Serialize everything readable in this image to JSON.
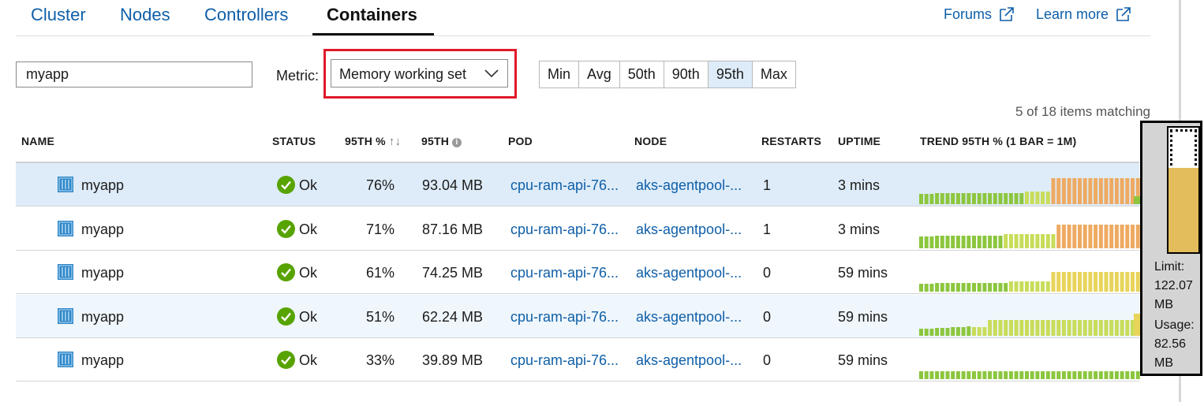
{
  "tabs": [
    {
      "label": "Cluster"
    },
    {
      "label": "Nodes"
    },
    {
      "label": "Controllers"
    },
    {
      "label": "Containers"
    }
  ],
  "links": {
    "forums": "Forums",
    "learn_more": "Learn more"
  },
  "filter": {
    "search_value": "myapp",
    "metric_label": "Metric:",
    "metric_value": "Memory working set"
  },
  "percentiles": [
    "Min",
    "Avg",
    "50th",
    "90th",
    "95th",
    "Max"
  ],
  "active_percentile": "95th",
  "matching": "5 of 18 items matching",
  "columns": {
    "name": "NAME",
    "status": "STATUS",
    "pct": "95TH %",
    "value": "95TH",
    "pod": "POD",
    "node": "NODE",
    "restarts": "RESTARTS",
    "uptime": "UPTIME",
    "trend": "TREND 95TH % (1 BAR = 1M)"
  },
  "rows": [
    {
      "name": "myapp",
      "status": "Ok",
      "pct": "76%",
      "value": "93.04 MB",
      "pod": "cpu-ram-api-76...",
      "node": "aks-agentpool-...",
      "restarts": "1",
      "uptime": "3 mins",
      "trend": [
        0.35,
        0.35,
        0.35,
        0.35,
        0.35,
        0.35,
        0.35,
        0.35,
        0.35,
        0.4,
        0.4,
        0.4,
        0.4,
        0.4,
        0.4,
        0.4,
        0.4,
        0.4,
        0.4,
        0.4,
        0.4,
        0.4,
        0.4,
        0.4,
        0.4,
        0.4,
        0.42,
        0.42,
        0.42,
        0.42,
        0.42,
        0.42,
        0.42,
        0.42,
        0.42,
        0.42,
        0.42,
        0.42,
        0.42,
        0.42,
        0.42,
        0.42,
        0.42,
        0.42,
        0.42,
        0.42,
        0.42,
        0.42,
        0.42,
        0.42,
        0.42,
        0.42,
        0.42,
        0.42,
        0.42,
        0.42,
        0.42,
        0.42,
        0.42,
        0.42,
        0.42,
        0.42,
        0.42,
        0.42,
        0.42,
        0.42,
        0.42,
        0.42,
        0.42,
        0.42,
        0.42,
        0.42,
        0.42,
        0.42,
        0.42,
        0.42,
        0.42,
        0.42,
        0.42,
        0.42,
        0.42,
        0.42,
        0.42,
        0.42,
        0.42,
        0.42,
        0.42,
        0.42,
        0.42,
        0.42,
        0.42,
        0.42,
        0.42,
        0.42,
        0.42,
        0.42,
        0.42,
        0.42,
        0.42,
        0.42,
        0.42,
        0.42,
        0.42,
        0.42,
        0.42,
        0.42,
        0.42,
        0.42,
        0.42,
        0.42,
        0.42,
        0.42,
        0.42,
        0.42,
        0.42,
        0.42,
        0.42,
        0.42,
        0.42,
        0.42,
        0.42,
        0.42,
        0.42,
        0.42,
        0.42,
        0.42,
        0.42,
        0.42,
        0.42,
        0.42,
        0.42,
        0.42,
        0.42,
        0.42,
        0.42,
        0.42,
        0.42,
        0.42,
        0.42,
        0.42,
        0.42,
        0.42,
        0.42,
        0.42,
        0.42,
        0.42,
        0.42,
        0.42,
        0.42,
        0.42,
        0.42,
        0.42,
        0.42,
        0.42,
        0.42,
        0.42,
        0.42,
        0.42,
        0.42,
        0.42,
        0.42,
        0.42,
        0.42,
        0.42,
        0.42,
        0.42,
        0.42,
        0.42,
        0.42,
        0.42,
        0.42,
        0.42,
        0.42,
        0.42,
        0.42,
        0.42,
        0.42,
        0.42,
        0.42,
        0.42,
        0.42,
        0.42,
        0.42,
        0.42,
        0.42,
        0.42,
        0.42,
        0.42,
        0.42,
        0.42,
        0.42,
        0.42,
        0.42,
        0.42,
        0.42,
        0.42,
        0.42,
        0.42,
        0.42,
        0.42,
        0.42,
        0.42,
        0.42,
        0.42,
        0.42,
        0.42,
        0.42,
        0.42,
        0.42,
        0.42,
        0.42,
        0.42,
        0.42,
        0.42,
        0.42,
        0.42,
        0.42,
        0.42,
        0.42,
        0.42,
        0.42,
        0.42,
        0.42,
        0.42,
        0.42,
        0.42,
        0.42,
        0.42,
        0.42,
        0.42,
        0.42,
        0.42,
        0.42,
        0.42,
        0.42,
        0.42,
        0.42,
        0.42,
        0.42,
        0.42,
        0.42,
        0.42,
        0.42,
        0.42,
        0.42,
        0.42,
        0.42,
        0.42,
        0.42,
        0.42,
        0.42,
        0.42,
        0.42,
        0.42,
        0.42,
        0.42,
        0.42,
        0.42,
        0.42,
        0.42,
        0.42,
        0.42,
        0.42,
        0.42,
        0.42,
        0.42
      ]
    },
    {
      "name": "myapp",
      "status": "Ok",
      "pct": "71%",
      "value": "87.16 MB",
      "pod": "cpu-ram-api-76...",
      "node": "aks-agentpool-...",
      "restarts": "1",
      "uptime": "3 mins",
      "trend": []
    },
    {
      "name": "myapp",
      "status": "Ok",
      "pct": "61%",
      "value": "74.25 MB",
      "pod": "cpu-ram-api-76...",
      "node": "aks-agentpool-...",
      "restarts": "0",
      "uptime": "59 mins",
      "trend": []
    },
    {
      "name": "myapp",
      "status": "Ok",
      "pct": "51%",
      "value": "62.24 MB",
      "pod": "cpu-ram-api-76...",
      "node": "aks-agentpool-...",
      "restarts": "0",
      "uptime": "59 mins",
      "trend": []
    },
    {
      "name": "myapp",
      "status": "Ok",
      "pct": "33%",
      "value": "39.89 MB",
      "pod": "cpu-ram-api-76...",
      "node": "aks-agentpool-...",
      "restarts": "0",
      "uptime": "59 mins",
      "trend": []
    }
  ],
  "trend_bars": [
    {
      "levels": [
        0.34,
        0.34,
        0.34,
        0.34,
        0.36,
        0.36,
        0.36,
        0.38,
        0.38,
        0.38,
        0.38,
        0.4,
        0.4,
        0.4,
        0.4,
        0.4,
        0.4,
        0.4,
        0.4,
        0.4,
        0.4,
        0.4,
        0.4,
        0.4,
        0.42,
        0.42,
        0.42,
        0.42,
        0.42,
        0.42,
        0.42,
        0.42,
        0.42,
        0.42,
        0.42,
        0.42,
        0.42,
        0.42,
        0.42,
        0.42,
        0.42,
        0.42,
        0.42,
        0.42,
        0.42,
        0.42,
        0.42,
        0.42,
        0.42,
        0.42,
        0.42,
        0.42,
        0.42,
        0.42,
        0.42,
        0.42,
        0.42,
        0.42,
        0.42,
        0.42,
        0.42,
        0.42,
        0.42,
        0.42,
        0.42,
        0.42,
        0.42,
        0.42,
        0.42,
        0.42,
        0.42,
        0.42,
        0.42,
        0.42,
        0.42,
        0.42,
        0.42,
        0.42,
        0.42,
        0.42,
        0.42,
        0.42,
        0.42,
        0.42,
        0.42,
        0.42,
        0.42,
        0.42,
        0.42,
        0.42,
        0.42,
        0.42,
        0.42,
        0.42,
        0.42,
        0.42,
        0.42,
        0.42,
        0.42,
        0.42,
        0.42,
        0.42,
        0.42,
        0.42,
        0.42,
        0.42,
        0.42,
        0.42,
        0.42,
        0.42,
        0.42,
        0.42,
        0.42,
        0.42,
        0.42,
        0.42,
        0.42,
        0.42,
        0.42,
        0.42,
        0.42,
        0.42,
        0.42,
        0.42,
        0.42,
        0.42,
        0.42,
        0.42,
        0.42,
        0.42,
        0.42,
        0.42,
        0.42,
        0.42,
        0.42,
        0.42,
        0.42,
        0.42,
        0.42,
        0.42,
        0.42,
        0.42,
        0.42,
        0.42,
        0.42,
        0.42,
        0.42,
        0.42,
        0.42,
        0.42,
        0.42,
        0.42,
        0.42,
        0.42,
        0.42,
        0.42,
        0.42,
        0.42,
        0.42,
        0.42,
        0.42,
        0.42,
        0.42,
        0.42,
        0.42,
        0.42,
        0.42,
        0.42,
        0.42,
        0.42,
        0.42,
        0.42,
        0.42,
        0.42,
        0.42,
        0.42,
        0.42,
        0.42,
        0.42,
        0.42,
        0.42,
        0.42,
        0.42,
        0.42,
        0.42,
        0.42,
        0.42,
        0.42,
        0.42,
        0.42,
        0.42,
        0.42,
        0.42,
        0.42,
        0.42,
        0.42,
        0.42,
        0.42,
        0.42,
        0.42,
        0.42,
        0.42,
        0.42,
        0.42,
        0.42,
        0.42,
        0.42,
        0.42,
        0.42,
        0.42,
        0.42,
        0.42,
        0.42,
        0.42,
        0.42,
        0.42,
        0.42,
        0.42,
        0.42,
        0.42,
        0.42,
        0.42,
        0.42,
        0.42,
        0.42,
        0.42,
        0.42,
        0.42,
        0.42,
        0.42,
        0.42,
        0.42,
        0.42,
        0.42,
        0.42,
        0.42,
        0.42,
        0.42,
        0.42,
        0.42,
        0.42,
        0.42,
        0.42,
        0.42,
        0.42,
        0.42,
        0.42,
        0.42,
        0.42,
        0.42,
        0.42,
        0.42,
        0.42,
        0.42,
        0.42,
        0.42,
        0.42,
        0.42,
        0.42,
        0.42,
        0.42,
        0.42,
        0.42,
        0.42,
        0.42,
        0.42,
        0.42,
        0.42,
        0.42,
        0.42,
        0.42,
        0.42,
        0.42,
        0.42,
        0.42,
        0.42,
        0.42,
        0.42,
        0.42,
        0.42,
        0.42,
        0.42,
        0.42,
        0.42,
        0.42,
        0.42,
        0.42,
        0.42,
        0.42,
        0.42,
        0.42,
        0.42,
        0.42,
        0.42,
        0.42,
        0.42,
        0.42,
        0.42,
        0.42,
        0.42
      ]
    }
  ],
  "tooltip": {
    "limit_label": "Limit:",
    "limit_value": "122.07",
    "limit_unit": "MB",
    "usage_label": "Usage:",
    "usage_value": "82.56",
    "usage_unit": "MB",
    "usage_fraction": 0.68
  },
  "colors": {
    "link": "#0f5fa8",
    "selected_row": "#deecf9",
    "bar_green": "#8cc63e",
    "bar_yellowgreen": "#c8dc59",
    "bar_yellow": "#e8d45a",
    "bar_orange": "#eeaa62",
    "ok": "#57a300"
  }
}
